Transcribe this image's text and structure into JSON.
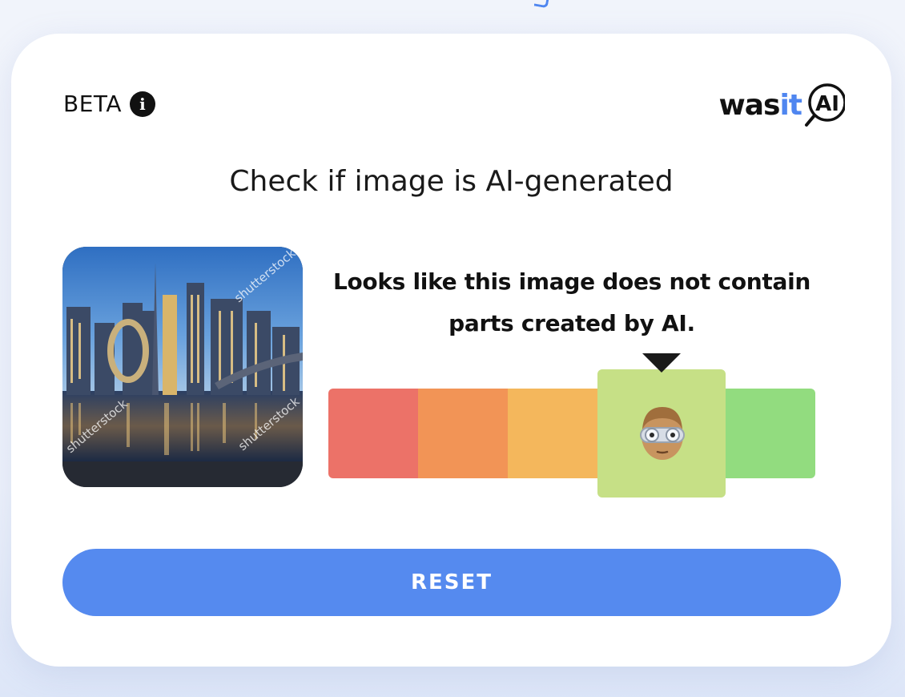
{
  "header": {
    "beta_label": "BETA",
    "info_icon": "info-icon",
    "logo_prefix": "was",
    "logo_accent": "it",
    "logo_suffix": "AI"
  },
  "main": {
    "title": "Check if image is AI-generated",
    "preview_watermark": "shutterstock",
    "result_message": "Looks like this image does not contain parts created by AI."
  },
  "meter": {
    "segment_colors": [
      "#ec7268",
      "#f29456",
      "#f4b75c",
      "#c4df84",
      "#92dc7f"
    ],
    "active_segment": 4,
    "indicator_icon": "nerd-face-emoji"
  },
  "actions": {
    "reset_label": "RESET"
  },
  "colors": {
    "accent": "#558aef",
    "logo_accent": "#4f86f0"
  }
}
